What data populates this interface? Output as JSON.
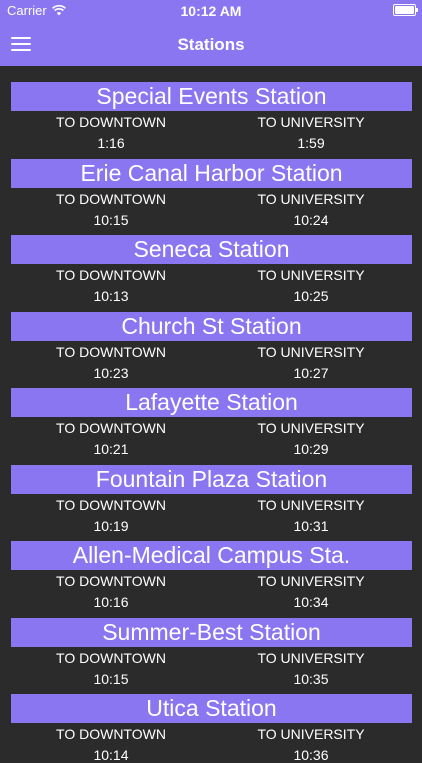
{
  "status_bar": {
    "carrier": "Carrier",
    "time": "10:12 AM"
  },
  "nav": {
    "title": "Stations",
    "menu_icon": "hamburger-menu-icon"
  },
  "colors": {
    "accent": "#8a76f0",
    "background": "#2b2b2b",
    "text": "#ffffff"
  },
  "labels": {
    "downtown": "TO DOWNTOWN",
    "university": "TO UNIVERSITY"
  },
  "stations": [
    {
      "name": "Special Events Station",
      "downtown": "1:16",
      "university": "1:59"
    },
    {
      "name": "Erie Canal Harbor Station",
      "downtown": "10:15",
      "university": "10:24"
    },
    {
      "name": "Seneca Station",
      "downtown": "10:13",
      "university": "10:25"
    },
    {
      "name": "Church St Station",
      "downtown": "10:23",
      "university": "10:27"
    },
    {
      "name": "Lafayette Station",
      "downtown": "10:21",
      "university": "10:29"
    },
    {
      "name": "Fountain Plaza Station",
      "downtown": "10:19",
      "university": "10:31"
    },
    {
      "name": "Allen-Medical Campus Sta.",
      "downtown": "10:16",
      "university": "10:34"
    },
    {
      "name": "Summer-Best Station",
      "downtown": "10:15",
      "university": "10:35"
    },
    {
      "name": "Utica Station",
      "downtown": "10:14",
      "university": "10:36"
    }
  ]
}
